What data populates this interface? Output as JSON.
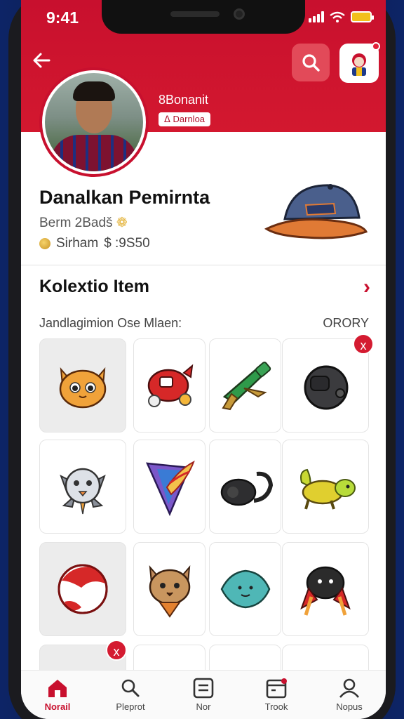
{
  "status": {
    "time": "9:41"
  },
  "header": {
    "club_name": "8Bonanit",
    "club_tag": "ᐃ Darnloa"
  },
  "profile": {
    "name": "Danalkan Pemirnta",
    "stat_line1": "Berm 2Badš",
    "stat_line2": "Sirham",
    "stat_value": "$ :9S50"
  },
  "collection": {
    "title": "Kolextio Item",
    "filter_label": "Jandlagimion Ose Mlaen:",
    "sort_label": "ORORY",
    "items": [
      {
        "icon": "cat-icon",
        "selected": true
      },
      {
        "icon": "robot-fish-icon"
      },
      {
        "icon": "blaster-icon"
      },
      {
        "icon": "helmet-icon",
        "removable": true
      },
      {
        "icon": "gear-skull-icon"
      },
      {
        "icon": "wing-shield-icon"
      },
      {
        "icon": "headphones-icon"
      },
      {
        "icon": "lizard-icon"
      },
      {
        "icon": "ball-icon",
        "selected": true
      },
      {
        "icon": "fox-icon"
      },
      {
        "icon": "blob-icon"
      },
      {
        "icon": "beetle-icon"
      }
    ]
  },
  "remove_label": "x",
  "tabs": [
    {
      "label": "Norail",
      "icon": "home-icon",
      "active": true
    },
    {
      "label": "Pleprot",
      "icon": "search-icon"
    },
    {
      "label": "Nor",
      "icon": "list-icon"
    },
    {
      "label": "Trook",
      "icon": "calendar-icon"
    },
    {
      "label": "Nopus",
      "icon": "profile-icon"
    }
  ],
  "colors": {
    "brand": "#c8102e",
    "accent": "#e24a59"
  }
}
